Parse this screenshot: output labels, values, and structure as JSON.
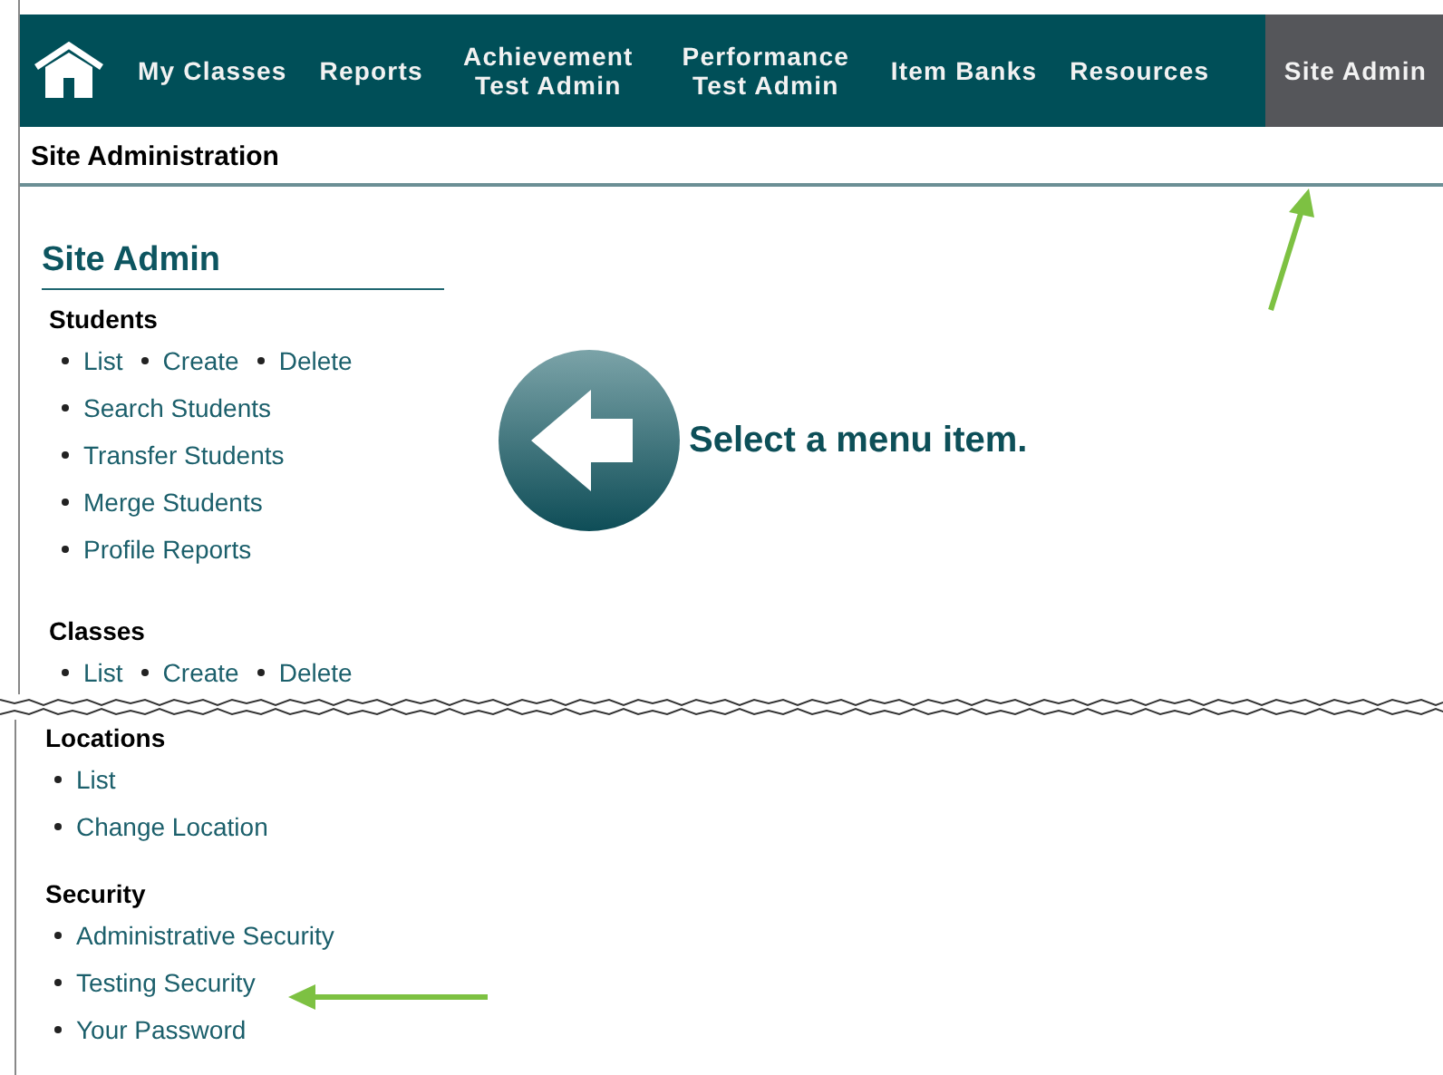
{
  "nav": {
    "items": [
      {
        "label": "My Classes",
        "selected": false
      },
      {
        "label": "Reports",
        "selected": false
      },
      {
        "label": "Achievement Test Admin",
        "selected": false
      },
      {
        "label": "Performance Test Admin",
        "selected": false
      },
      {
        "label": "Item Banks",
        "selected": false
      },
      {
        "label": "Resources",
        "selected": false
      },
      {
        "label": "Site Admin",
        "selected": true
      }
    ]
  },
  "page_title": "Site Administration",
  "menu_title": "Site Admin",
  "top_sections": [
    {
      "heading": "Students",
      "rows": [
        [
          "List",
          "Create",
          "Delete"
        ],
        [
          "Search Students"
        ],
        [
          "Transfer Students"
        ],
        [
          "Merge Students"
        ],
        [
          "Profile Reports"
        ]
      ]
    },
    {
      "heading": "Classes",
      "rows": [
        [
          "List",
          "Create",
          "Delete"
        ]
      ]
    }
  ],
  "prompt": "Select a menu item.",
  "bottom_sections": [
    {
      "heading": "Locations",
      "rows": [
        [
          "List"
        ],
        [
          "Change Location"
        ]
      ]
    },
    {
      "heading": "Security",
      "rows": [
        [
          "Administrative Security"
        ],
        [
          "Testing Security"
        ],
        [
          "Your Password"
        ]
      ]
    }
  ]
}
